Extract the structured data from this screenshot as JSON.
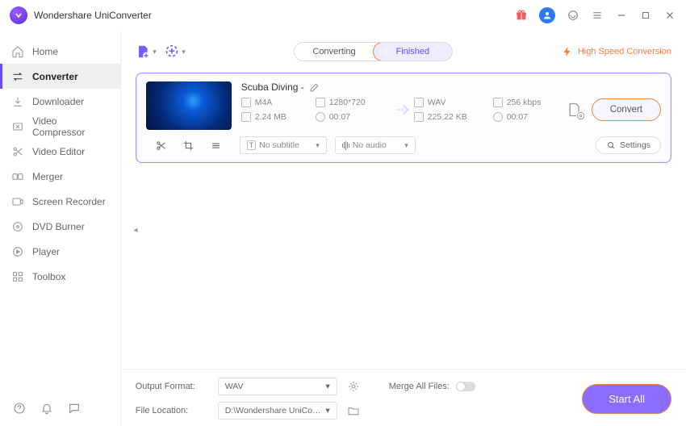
{
  "app": {
    "title": "Wondershare UniConverter"
  },
  "window_controls": {
    "gift": "gift-icon",
    "user": "user-icon",
    "support": "support-icon",
    "menu": "menu-icon",
    "minimize": "minimize-icon",
    "maximize": "maximize-icon",
    "close": "close-icon"
  },
  "sidebar": {
    "items": [
      {
        "id": "home",
        "label": "Home"
      },
      {
        "id": "converter",
        "label": "Converter"
      },
      {
        "id": "downloader",
        "label": "Downloader"
      },
      {
        "id": "video-compressor",
        "label": "Video Compressor"
      },
      {
        "id": "video-editor",
        "label": "Video Editor"
      },
      {
        "id": "merger",
        "label": "Merger"
      },
      {
        "id": "screen-recorder",
        "label": "Screen Recorder"
      },
      {
        "id": "dvd-burner",
        "label": "DVD Burner"
      },
      {
        "id": "player",
        "label": "Player"
      },
      {
        "id": "toolbox",
        "label": "Toolbox"
      }
    ],
    "active": "converter"
  },
  "tabs": {
    "converting": "Converting",
    "finished": "Finished",
    "active": "finished"
  },
  "highspeed_label": "High Speed Conversion",
  "file": {
    "title": "Scuba Diving -",
    "src": {
      "format": "M4A",
      "resolution": "1280*720",
      "filesize": "2.24 MB",
      "duration": "00:07"
    },
    "dst": {
      "format": "WAV",
      "bitrate": "256 kbps",
      "filesize": "225.22 KB",
      "duration": "00:07"
    },
    "subtitle_select": "No subtitle",
    "audio_select": "No audio",
    "settings_label": "Settings",
    "convert_label": "Convert"
  },
  "bottom": {
    "output_format_label": "Output Format:",
    "output_format_value": "WAV",
    "file_location_label": "File Location:",
    "file_location_value": "D:\\Wondershare UniConverter",
    "merge_label": "Merge All Files:",
    "start_all_label": "Start All"
  }
}
